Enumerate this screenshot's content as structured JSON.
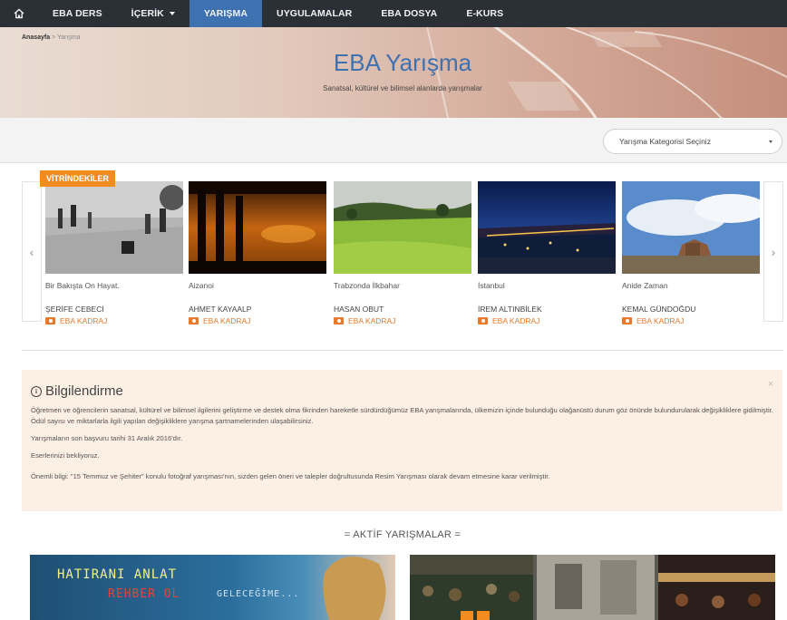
{
  "nav": {
    "items": [
      {
        "label": "EBA DERS"
      },
      {
        "label": "İÇERİK"
      },
      {
        "label": "YARIŞMA"
      },
      {
        "label": "UYGULAMALAR"
      },
      {
        "label": "EBA DOSYA"
      },
      {
        "label": "E-KURS"
      }
    ],
    "active_index": 2,
    "active_color": "#3d71b0",
    "bar_color": "#2b2f36"
  },
  "breadcrumb": {
    "home": "Anasayfa",
    "separator": ">",
    "current": "Yarışma"
  },
  "hero": {
    "title": "EBA Yarışma",
    "subtitle": "Sanatsal, kültürel ve bilimsel alanlarda yarışmalar"
  },
  "filter": {
    "category_placeholder": "Yarışma Kategorisi Seçiniz"
  },
  "showcase": {
    "badge": "VİTRİNDEKİLER",
    "prev_icon": "‹",
    "next_icon": "›",
    "cards": [
      {
        "title": "Bir Bakışta On Hayat.",
        "author": "ŞERİFE CEBECİ",
        "channel": "EBA KADRAJ"
      },
      {
        "title": "Aizanoi",
        "author": "AHMET KAYAALP",
        "channel": "EBA KADRAJ"
      },
      {
        "title": "Trabzonda İlkbahar",
        "author": "HASAN OBUT",
        "channel": "EBA KADRAJ"
      },
      {
        "title": "İstanbul",
        "author": "İREM ALTINBİLEK",
        "channel": "EBA KADRAJ"
      },
      {
        "title": "Anide Zaman",
        "author": "KEMAL GÜNDOĞDU",
        "channel": "EBA KADRAJ"
      }
    ]
  },
  "info": {
    "heading": "Bilgilendirme",
    "icon_glyph": "i",
    "close": "×",
    "paragraphs": [
      "Öğretmen ve öğrencilerin sanatsal, kültürel ve bilimsel ilgilerini geliştirme ve destek olma fikrinden hareketle sürdürdüğümüz EBA yarışmalarında, ülkemizin içinde bulunduğu olağanüstü durum göz önünde bulundurularak değişikliklere gidilmiştir. Ödül sayısı ve miktarlarla ilgili yapılan değişikliklere yarışma şartnamelerinden ulaşabilirsiniz.",
      "Yarışmaların son başvuru tarihi 31 Aralık 2016'dır.",
      "Eserlerinizi bekliyoruz.",
      "Önemli bilgi: \"15 Temmuz ve Şehiter\" konulu fotoğraf yarışması'nın, sizden gelen öneri ve talepler doğrultusunda Resim Yarışması olarak devam etmesine karar verilmiştir."
    ]
  },
  "active": {
    "title": "= AKTİF YARIŞMALAR =",
    "banner_left": {
      "line1": "HATIRANI ANLAT",
      "line2": "REHBER OL",
      "line3": "GELECEĞİME..."
    }
  }
}
